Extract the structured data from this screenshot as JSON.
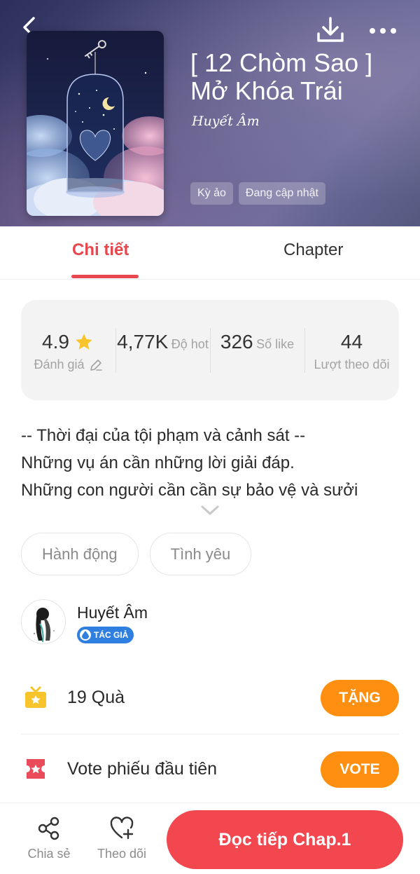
{
  "header": {
    "title_line1": "[ 12 Chòm Sao ]",
    "title_line2": "Mở Khóa Trái",
    "author_script": "Huyết Âm",
    "tags": [
      "Kỳ ảo",
      "Đang cập nhật"
    ],
    "icons": {
      "back": "back-arrow-icon",
      "download": "download-icon",
      "more": "more-dots-icon"
    }
  },
  "tabs": [
    {
      "label": "Chi tiết",
      "active": true
    },
    {
      "label": "Chapter",
      "active": false
    }
  ],
  "stats": [
    {
      "value": "4.9",
      "label": "Đánh giá"
    },
    {
      "value": "4,77K",
      "label": "Độ hot"
    },
    {
      "value": "326",
      "label": "Số like"
    },
    {
      "value": "44",
      "label": "Lượt theo dõi"
    }
  ],
  "description": [
    "-- Thời đại của tội phạm và cảnh sát --",
    "Những vụ án cần những lời giải đáp.",
    "Những con người cần cần sự bảo vệ và sưởi"
  ],
  "genres": [
    "Hành động",
    "Tình yêu"
  ],
  "author": {
    "name": "Huyết Âm",
    "badge": "TÁC GIẢ"
  },
  "gift": {
    "text": "19 Quà",
    "button": "TẶNG"
  },
  "vote": {
    "text": "Vote phiếu đầu tiên",
    "button": "VOTE"
  },
  "bottom_bar": {
    "share_label": "Chia sẻ",
    "follow_label": "Theo dõi",
    "read_button": "Đọc tiếp Chap.1"
  },
  "colors": {
    "accent_red": "#e8474d",
    "button_orange": "#ff8f10",
    "read_red": "#f2474f",
    "badge_blue": "#2f7fe0",
    "star_yellow": "#f7c52b"
  }
}
